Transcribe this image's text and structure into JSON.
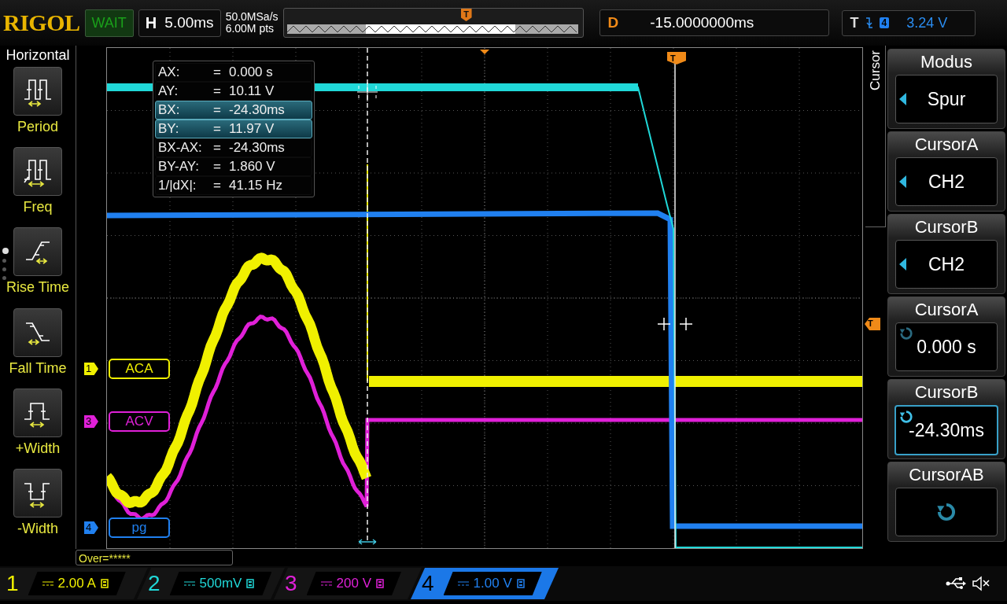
{
  "top_bar": {
    "brand": "RIGOL",
    "run_status": "WAIT",
    "horizontal": {
      "label": "H",
      "timebase": "5.00ms",
      "sample_rate": "50.0MSa/s",
      "memory_depth": "6.00M pts",
      "marker": "T"
    },
    "delay": {
      "label": "D",
      "value": "-15.0000000ms"
    },
    "trigger": {
      "label": "T",
      "channel": "4",
      "level": "3.24 V"
    }
  },
  "left_menu": {
    "title": "Horizontal",
    "items": [
      {
        "label": "Period",
        "kind": "period"
      },
      {
        "label": "Freq",
        "kind": "freq"
      },
      {
        "label": "Rise Time",
        "kind": "rise"
      },
      {
        "label": "Fall Time",
        "kind": "fall"
      },
      {
        "label": "+Width",
        "kind": "pos_width"
      },
      {
        "label": "-Width",
        "kind": "neg_width"
      }
    ],
    "pages": [
      {
        "selected": true
      },
      {
        "selected": false
      },
      {
        "selected": false
      },
      {
        "selected": false
      }
    ]
  },
  "cursor_readout": [
    {
      "label": "AX:",
      "sign": "=",
      "value": "0.000 s",
      "selected": false
    },
    {
      "label": "AY:",
      "sign": "=",
      "value": "10.11 V",
      "selected": false
    },
    {
      "label": "BX:",
      "sign": "=",
      "value": "-24.30ms",
      "selected": true
    },
    {
      "label": "BY:",
      "sign": "=",
      "value": "11.97 V",
      "selected": true
    },
    {
      "label": "BX-AX:",
      "sign": "=",
      "value": "-24.30ms",
      "selected": false
    },
    {
      "label": "BY-AY:",
      "sign": "=",
      "value": "1.860 V",
      "selected": false
    },
    {
      "label": "1/|dX|:",
      "sign": "=",
      "value": "41.15 Hz",
      "selected": false
    }
  ],
  "channel_labels": [
    {
      "number": "1",
      "name": "ACA",
      "color": "#f0f000"
    },
    {
      "number": "3",
      "name": "ACV",
      "color": "#e020d8"
    },
    {
      "number": "4",
      "name": "pg",
      "color": "#2080f0"
    }
  ],
  "trigger_markers": {
    "top": "T",
    "right": "T"
  },
  "status_line": "Over=*****",
  "right_menu": {
    "title": "Cursor",
    "items": [
      {
        "title": "Modus",
        "value": "Spur",
        "kind": "select",
        "selected": false
      },
      {
        "title": "CursorA",
        "value": "CH2",
        "kind": "select",
        "selected": false
      },
      {
        "title": "CursorB",
        "value": "CH2",
        "kind": "select",
        "selected": false
      },
      {
        "title": "CursorA",
        "value": "0.000 s",
        "kind": "knob",
        "selected": false
      },
      {
        "title": "CursorB",
        "value": "-24.30ms",
        "kind": "knob",
        "selected": true
      },
      {
        "title": "CursorAB",
        "kind": "knob",
        "selected": false
      }
    ]
  },
  "channels": [
    {
      "number": "1",
      "scale": "2.00 A",
      "color": "#f0f000",
      "selected": false
    },
    {
      "number": "2",
      "scale": "500mV",
      "color": "#20d8d8",
      "selected": false
    },
    {
      "number": "3",
      "scale": "200 V",
      "color": "#e020d8",
      "selected": false
    },
    {
      "number": "4",
      "scale": "1.00 V",
      "color": "#2080f0",
      "selected": true
    }
  ]
}
